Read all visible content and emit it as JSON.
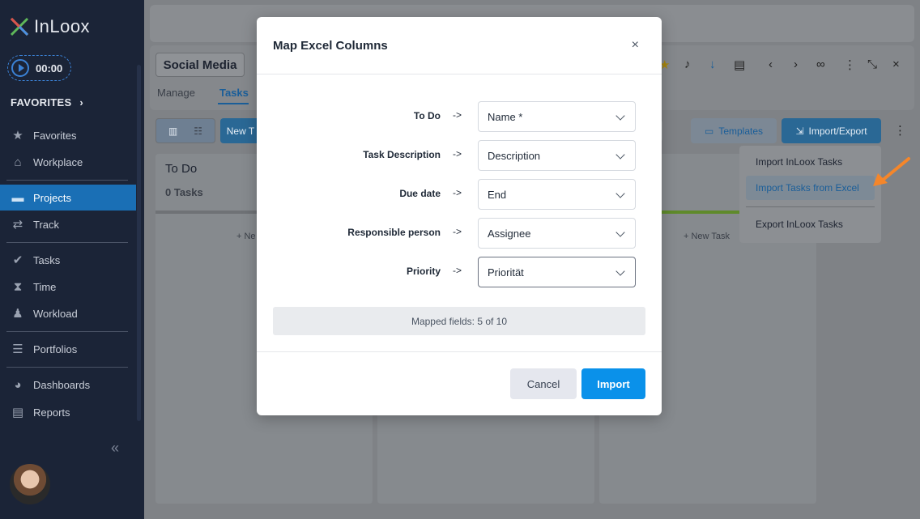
{
  "sidebar": {
    "logo_text": "InLoox",
    "timer": "00:00",
    "favorites_heading": "FAVORITES",
    "items": [
      {
        "label": "Favorites",
        "icon": "star-icon"
      },
      {
        "label": "Workplace",
        "icon": "house-icon"
      },
      {
        "label": "Projects",
        "icon": "folder-icon",
        "active": true
      },
      {
        "label": "Track",
        "icon": "arrows-icon"
      },
      {
        "label": "Tasks",
        "icon": "check-circle-icon"
      },
      {
        "label": "Time",
        "icon": "hourglass-icon"
      },
      {
        "label": "Workload",
        "icon": "person-icon"
      },
      {
        "label": "Portfolios",
        "icon": "tree-icon"
      },
      {
        "label": "Dashboards",
        "icon": "pie-icon"
      },
      {
        "label": "Reports",
        "icon": "report-icon"
      }
    ],
    "collapse_glyph": "«"
  },
  "project": {
    "title": "Social Media",
    "tabs": [
      "Manage",
      "Tasks"
    ],
    "active_tab": "Tasks",
    "new_task_button": "New T",
    "templates_button": "Templates",
    "import_export_button": "Import/Export"
  },
  "board": {
    "columns": [
      {
        "title": "To Do",
        "count": "0 Tasks",
        "new_label": "+ Ne"
      },
      {
        "title": "",
        "count": "",
        "new_label": ""
      },
      {
        "title": "",
        "count": "",
        "new_label": "+ New Task"
      }
    ]
  },
  "menu": {
    "items": [
      "Import InLoox Tasks",
      "Import Tasks from Excel",
      "Export InLoox Tasks"
    ],
    "highlighted": "Import Tasks from Excel"
  },
  "modal": {
    "title": "Map Excel Columns",
    "close_glyph": "×",
    "mappings": [
      {
        "field": "To Do",
        "arrow": "->",
        "value": "Name *"
      },
      {
        "field": "Task Description",
        "arrow": "->",
        "value": "Description"
      },
      {
        "field": "Due date",
        "arrow": "->",
        "value": "End"
      },
      {
        "field": "Responsible person",
        "arrow": "->",
        "value": "Assignee"
      },
      {
        "field": "Priority",
        "arrow": "->",
        "value": "Priorität"
      }
    ],
    "mapped_status": "Mapped fields: 5 of 10",
    "cancel_label": "Cancel",
    "import_label": "Import"
  },
  "colors": {
    "sidebar_bg": "#1b2437",
    "active_nav": "#1a6fb5",
    "primary_button": "#0a91ea",
    "arrow_annotation": "#f5862a"
  }
}
